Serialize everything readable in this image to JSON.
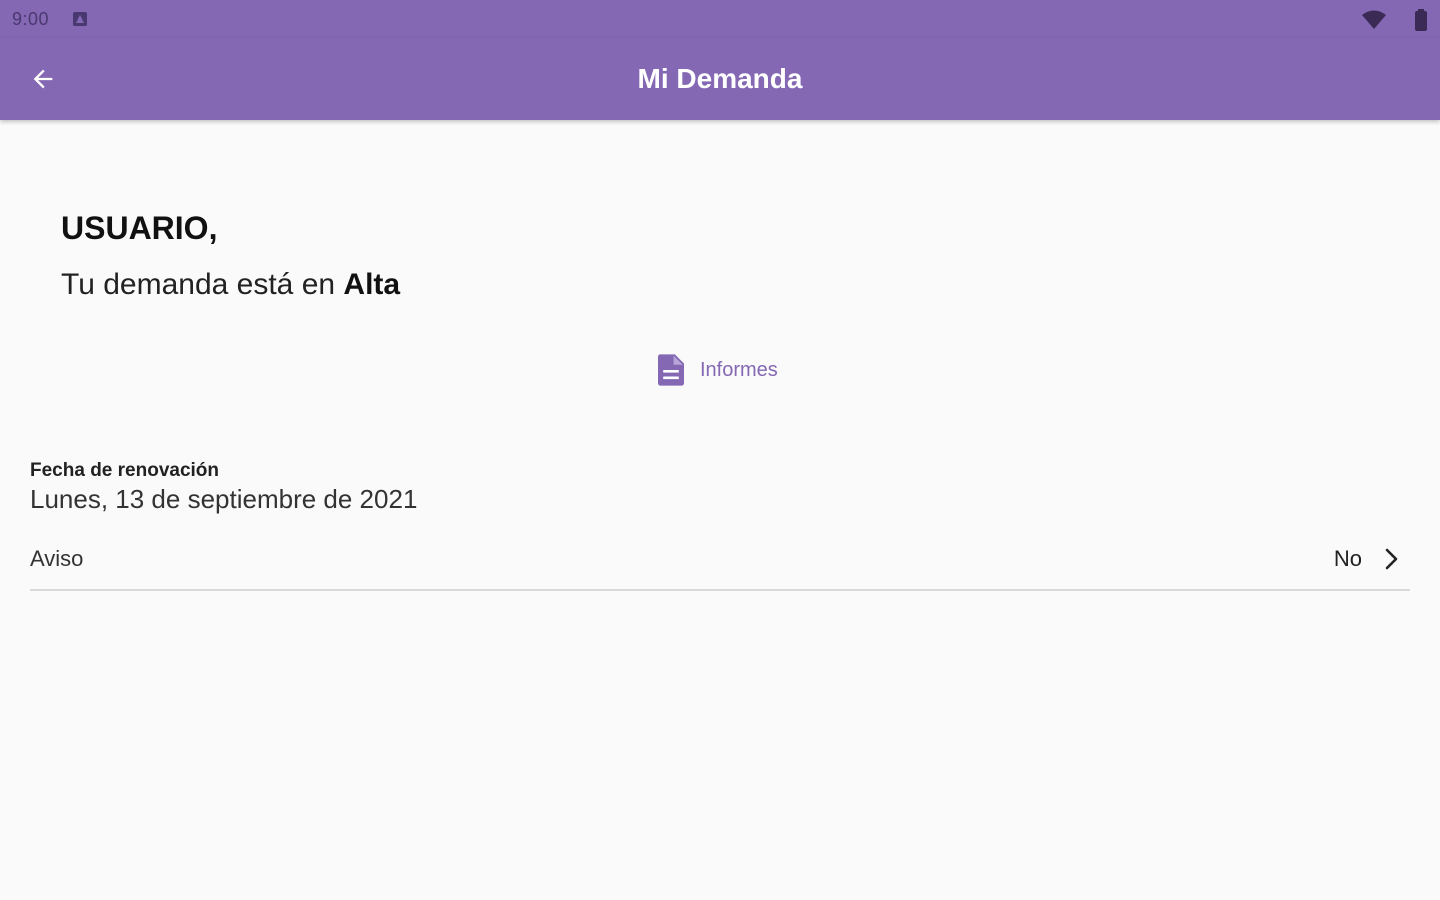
{
  "status_bar": {
    "time": "9:00"
  },
  "app_bar": {
    "title": "Mi Demanda",
    "back_icon": "arrow-back-icon"
  },
  "content": {
    "greeting": "USUARIO,",
    "status_prefix": "Tu demanda está en ",
    "status_value": "Alta",
    "informes_label": "Informes",
    "informes_icon": "document-icon",
    "renewal_label": "Fecha de renovación",
    "renewal_value": "Lunes, 13 de septiembre de 2021",
    "aviso_label": "Aviso",
    "aviso_value": "No"
  },
  "colors": {
    "primary": "#8468b4",
    "background": "#fafafa",
    "app_bar_text": "#ffffff"
  }
}
